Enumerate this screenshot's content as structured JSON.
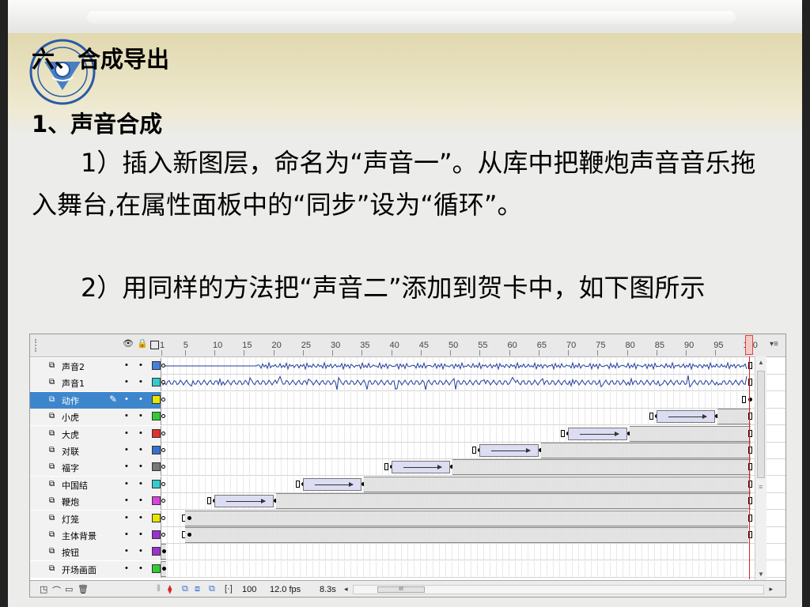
{
  "slide": {
    "heading": "六、合成导出",
    "subheading": "1、声音合成",
    "paragraph1": "1）插入新图层，命名为“声音一”。从库中把鞭炮声音音乐拖入舞台,在属性面板中的“同步”设为“循环”。",
    "paragraph2": "2）用同样的方法把“声音二”添加到贺卡中，如下图所示"
  },
  "timeline": {
    "header_icons": [
      "eye-icon",
      "lock-icon",
      "outline-icon"
    ],
    "ruler_labels": [
      "1",
      "5",
      "10",
      "15",
      "20",
      "25",
      "30",
      "35",
      "40",
      "45",
      "50",
      "55",
      "60",
      "65",
      "70",
      "75",
      "80",
      "85",
      "90",
      "95",
      "100"
    ],
    "menu_glyph": "▾≡",
    "current_frame_marker": 100,
    "layers": [
      {
        "name": "声音2",
        "color": "#4a7fd8",
        "selected": false,
        "kind": "sound"
      },
      {
        "name": "声音1",
        "color": "#33cccc",
        "selected": false,
        "kind": "sound"
      },
      {
        "name": "动作",
        "color": "#e6e600",
        "selected": true,
        "kind": "action"
      },
      {
        "name": "小虎",
        "color": "#33cc33",
        "selected": false,
        "kind": "tween",
        "tween": [
          85,
          95
        ]
      },
      {
        "name": "大虎",
        "color": "#e03030",
        "selected": false,
        "kind": "tween",
        "tween": [
          70,
          80
        ]
      },
      {
        "name": "对联",
        "color": "#3a6fd0",
        "selected": false,
        "kind": "tween",
        "tween": [
          55,
          65
        ]
      },
      {
        "name": "福字",
        "color": "#777777",
        "selected": false,
        "kind": "tween",
        "tween": [
          40,
          50
        ]
      },
      {
        "name": "中国结",
        "color": "#33cccc",
        "selected": false,
        "kind": "tween",
        "tween": [
          25,
          35
        ]
      },
      {
        "name": "鞭炮",
        "color": "#e040e0",
        "selected": false,
        "kind": "tween",
        "tween": [
          10,
          20
        ]
      },
      {
        "name": "灯笼",
        "color": "#e6e600",
        "selected": false,
        "kind": "static",
        "start": 5
      },
      {
        "name": "主体背景",
        "color": "#9933cc",
        "selected": false,
        "kind": "static",
        "start": 5
      },
      {
        "name": "按钮",
        "color": "#9933cc",
        "selected": false,
        "kind": "single"
      },
      {
        "name": "开场画面",
        "color": "#33cc33",
        "selected": false,
        "kind": "single"
      }
    ],
    "footer": {
      "frame": "100",
      "fps": "12.0 fps",
      "time": "8.3s",
      "scroll_thumb": "III"
    }
  }
}
